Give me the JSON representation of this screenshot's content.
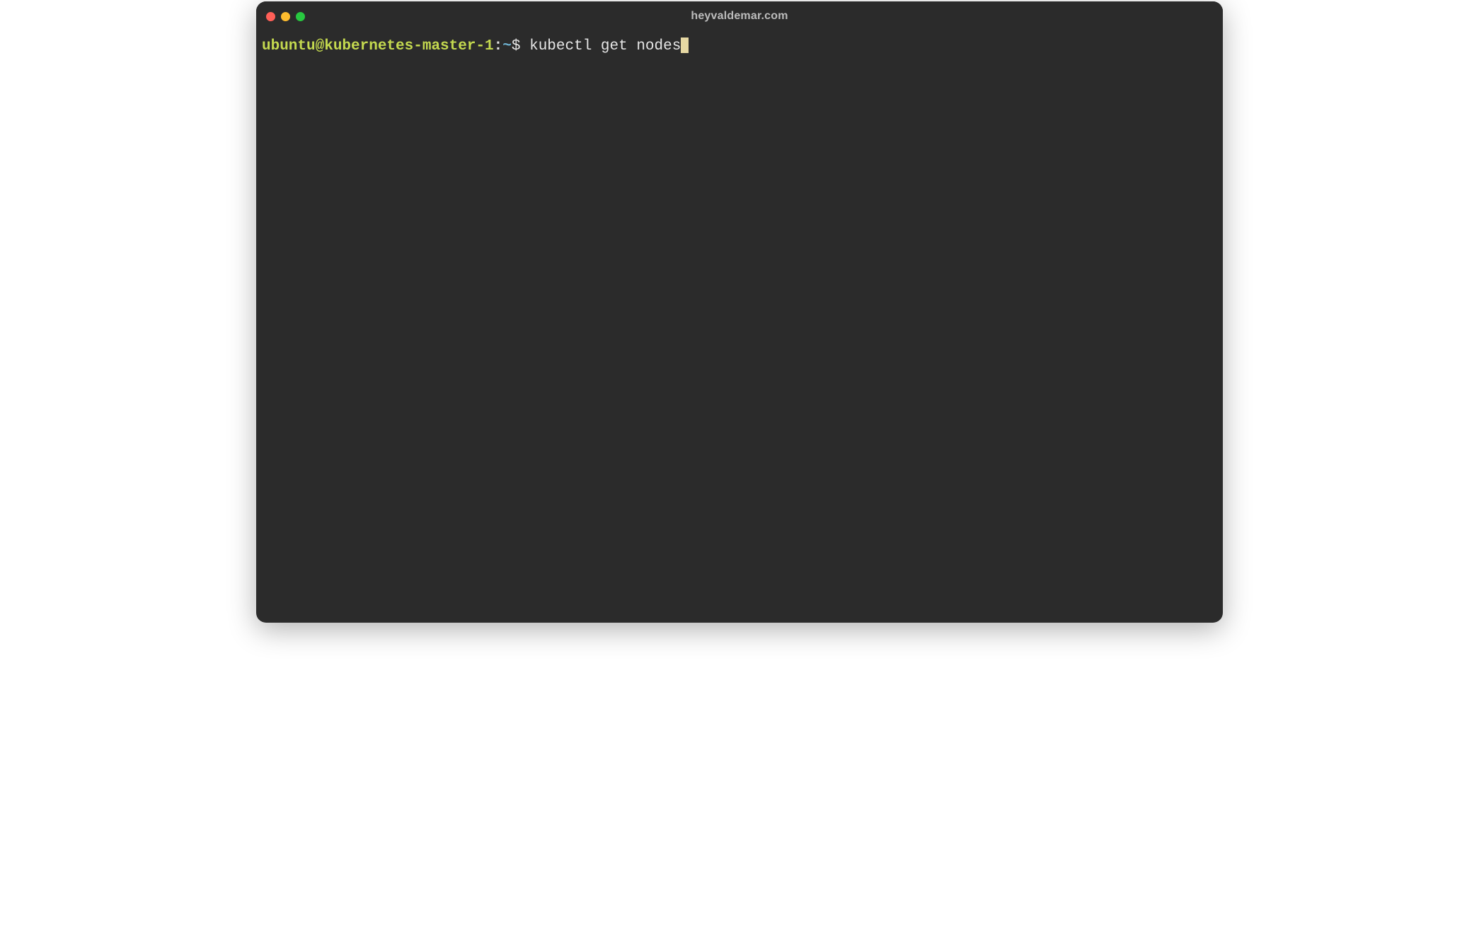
{
  "window": {
    "title": "heyvaldemar.com"
  },
  "prompt": {
    "user_host": "ubuntu@kubernetes-master-1",
    "separator": ":",
    "path": "~",
    "symbol": "$",
    "command": "kubectl get nodes"
  },
  "colors": {
    "window_bg": "#2b2b2b",
    "traffic_close": "#ff5f57",
    "traffic_min": "#febc2e",
    "traffic_max": "#28c840",
    "user_host_fg": "#c4d94f",
    "path_fg": "#6fb3d2",
    "text_fg": "#e6e6e6",
    "cursor": "#e6d8a3"
  }
}
